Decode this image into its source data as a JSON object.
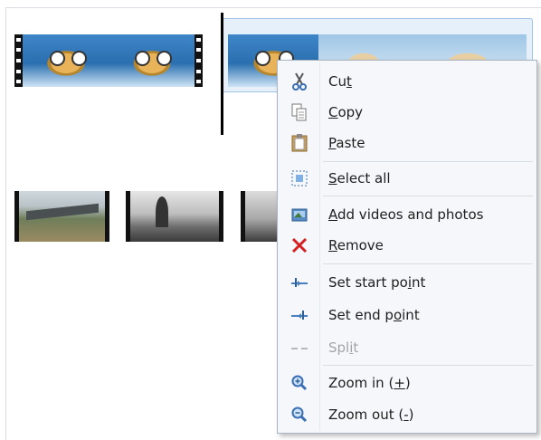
{
  "menu": {
    "items": [
      {
        "id": "cut",
        "pre": "Cu",
        "acc": "t",
        "post": "",
        "icon": "scissors-icon"
      },
      {
        "id": "copy",
        "pre": "",
        "acc": "C",
        "post": "opy",
        "icon": "copy-icon"
      },
      {
        "id": "paste",
        "pre": "",
        "acc": "P",
        "post": "aste",
        "icon": "paste-icon"
      },
      {
        "id": "select-all",
        "pre": "",
        "acc": "S",
        "post": "elect all",
        "icon": "select-all-icon"
      },
      {
        "id": "add-videos",
        "pre": "",
        "acc": "A",
        "post": "dd videos and photos",
        "icon": "add-media-icon"
      },
      {
        "id": "remove",
        "pre": "",
        "acc": "R",
        "post": "emove",
        "icon": "remove-icon"
      },
      {
        "id": "set-start",
        "pre": "Set start po",
        "acc": "i",
        "post": "nt",
        "icon": "set-start-point-icon"
      },
      {
        "id": "set-end",
        "pre": "Set end p",
        "acc": "o",
        "post": "int",
        "icon": "set-end-point-icon"
      },
      {
        "id": "split",
        "pre": "Spl",
        "acc": "i",
        "post": "t",
        "icon": "split-icon",
        "disabled": true
      },
      {
        "id": "zoom-in",
        "pre": "Zoom in (",
        "acc": "+",
        "post": ")",
        "icon": "zoom-in-icon"
      },
      {
        "id": "zoom-out",
        "pre": "Zoom out (",
        "acc": "-",
        "post": ")",
        "icon": "zoom-out-icon"
      }
    ]
  },
  "colors": {
    "menu_bg": "#f5f7fa",
    "menu_border": "#a9b5c3",
    "selection_fill": "#e6f0fa",
    "remove_red": "#d42020",
    "disabled_text": "#a5a5a5"
  }
}
